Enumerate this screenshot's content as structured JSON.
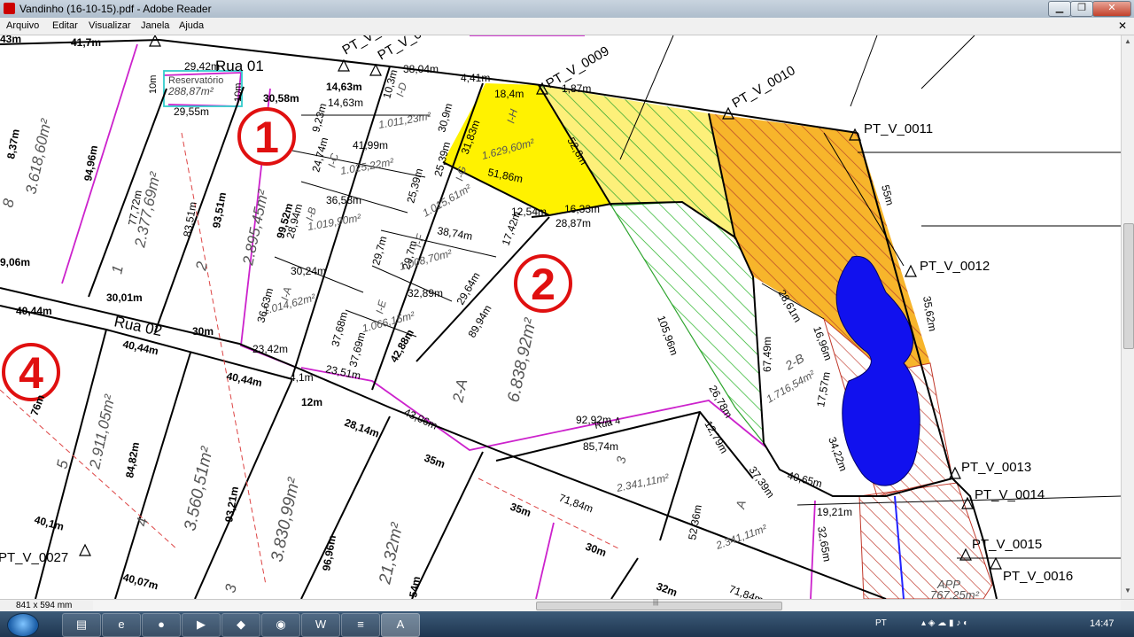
{
  "window": {
    "title": "Vandinho (16-10-15).pdf - Adobe Reader",
    "controls": {
      "minimize": "▁",
      "maximize": "❐",
      "close": "✕"
    }
  },
  "menu": {
    "items": [
      "Arquivo",
      "Editar",
      "Visualizar",
      "Janela",
      "Ajuda"
    ],
    "close_glyph": "✕"
  },
  "status": {
    "page_size": "841 x 594 mm"
  },
  "map": {
    "streets": {
      "rua01": "Rua 01",
      "rua02": "Rua 02",
      "rua4": "Rua 4"
    },
    "area_numbers": {
      "a1": "1",
      "a2": "2",
      "a4": "4"
    },
    "reservatorio": {
      "label": "Reservatório",
      "area": "288,87m²",
      "side_left": "10m",
      "side_right": "10m"
    },
    "points": [
      "PT_V_",
      "PT_V_0",
      "PT_V_0009",
      "PT_V_0010",
      "PT_V_0011",
      "PT_V_0012",
      "PT_V_0013",
      "PT_V_0014",
      "PT_V_0015",
      "PT_V_0016",
      "PT_V_0027"
    ],
    "lots": {
      "l8": "8",
      "l8_area": "3.618,60m²",
      "l1": "1",
      "l1_area": "2.377,69m²",
      "l2": "2",
      "l2_area": "2.895,45m²",
      "lID": "I-D",
      "lID_area": "1.011,23m²",
      "lIC": "I-C",
      "lIC_area": "1.025,22m²",
      "lIB": "I-B",
      "lIB_area": "1.019,90m²",
      "lIA": "I-A",
      "lIA_area": "1.014,62m²",
      "lIE": "I-E",
      "lIE_area": "1.066,15m²",
      "lIF": "I-F",
      "lIF_area": "1.008,70m²",
      "lIG": "I-G",
      "lIG_area": "1.015,61m²",
      "lIH": "I-H",
      "lIH_area": "1.629,60m²",
      "l2A": "2-A",
      "l2A_area": "6.838,92m²",
      "l2B": "2-B",
      "l2B_area": "1.716,54m²",
      "l3": "3",
      "l3_area": "2.341,11m²",
      "lA": "A",
      "lA_area": "2.341,11m²",
      "l5": "5",
      "l5_area": "2.911,05m²",
      "l4": "4",
      "l4_area": "3.560,51m²",
      "l3b": "3",
      "l3b_area": "3.830,99m²",
      "l21_area": "21,32m²",
      "app": "APP",
      "app_area": "767,25m²"
    },
    "dims": {
      "d1": "43m",
      "d2": "41,7m",
      "d3": "29,42m",
      "d4": "29,55m",
      "d5": "30,58m",
      "d6": "14,63m",
      "d7": "14,63m",
      "d8": "38,04m",
      "d9": "4,41m",
      "d10": "10,3m",
      "d11": "18,4m",
      "d12": "1,87m",
      "d13": "30,9m",
      "d14": "9,23m",
      "d15": "41,99m",
      "d16": "24,74m",
      "d17": "31,83m",
      "d18": "52,8m",
      "d19": "51,86m",
      "d20": "25,39m",
      "d21": "25,39m",
      "d22": "36,58m",
      "d23": "28,94m",
      "d24": "99,52m",
      "d25": "12,54m",
      "d26": "16,33m",
      "d27": "28,87m",
      "d28": "38,74m",
      "d29": "17,42m",
      "d30": "29,7m",
      "d31": "29,7m",
      "d32": "77,72m",
      "d33": "83,51m",
      "d34": "93,51m",
      "d35": "94,96m",
      "d36": "30,24m",
      "d37": "36,63m",
      "d38": "32,89m",
      "d39": "29,64m",
      "d40": "37,68m",
      "d41": "37,69m",
      "d42": "42,88m",
      "d43": "89,94m",
      "d44": "30,01m",
      "d45": "30m",
      "d46": "23,42m",
      "d47": "4,1m",
      "d48": "23,51m",
      "d49": "40,44m",
      "d50": "40,44m",
      "d51": "40,44m",
      "d52": "12m",
      "d53": "28,14m",
      "d54": "43,06m",
      "d55": "92,92m",
      "d56": "85,74m",
      "d57": "12,79m",
      "d58": "105,96m",
      "d59": "26,78m",
      "d60": "67,49m",
      "d61": "28,61m",
      "d62": "16,96m",
      "d63": "17,57m",
      "d64": "34,22m",
      "d65": "40,65m",
      "d66": "37,39m",
      "d67": "52,36m",
      "d68": "19,21m",
      "d69": "32,65m",
      "d70": "55m",
      "d71": "35,62m",
      "d72": "76m",
      "d73": "84,82m",
      "d74": "93,21m",
      "d75": "96,96m",
      "d76": "35m",
      "d77": "35m",
      "d78": "71,84m",
      "d79": "71,84m",
      "d80": "30m",
      "d81": "32m",
      "d82": "40,1m",
      "d83": "40,07m",
      "d84": "9,06m",
      "d85": "54m",
      "d86": "8,37m"
    }
  },
  "taskbar": {
    "lang": "PT",
    "clock": "14:47"
  }
}
